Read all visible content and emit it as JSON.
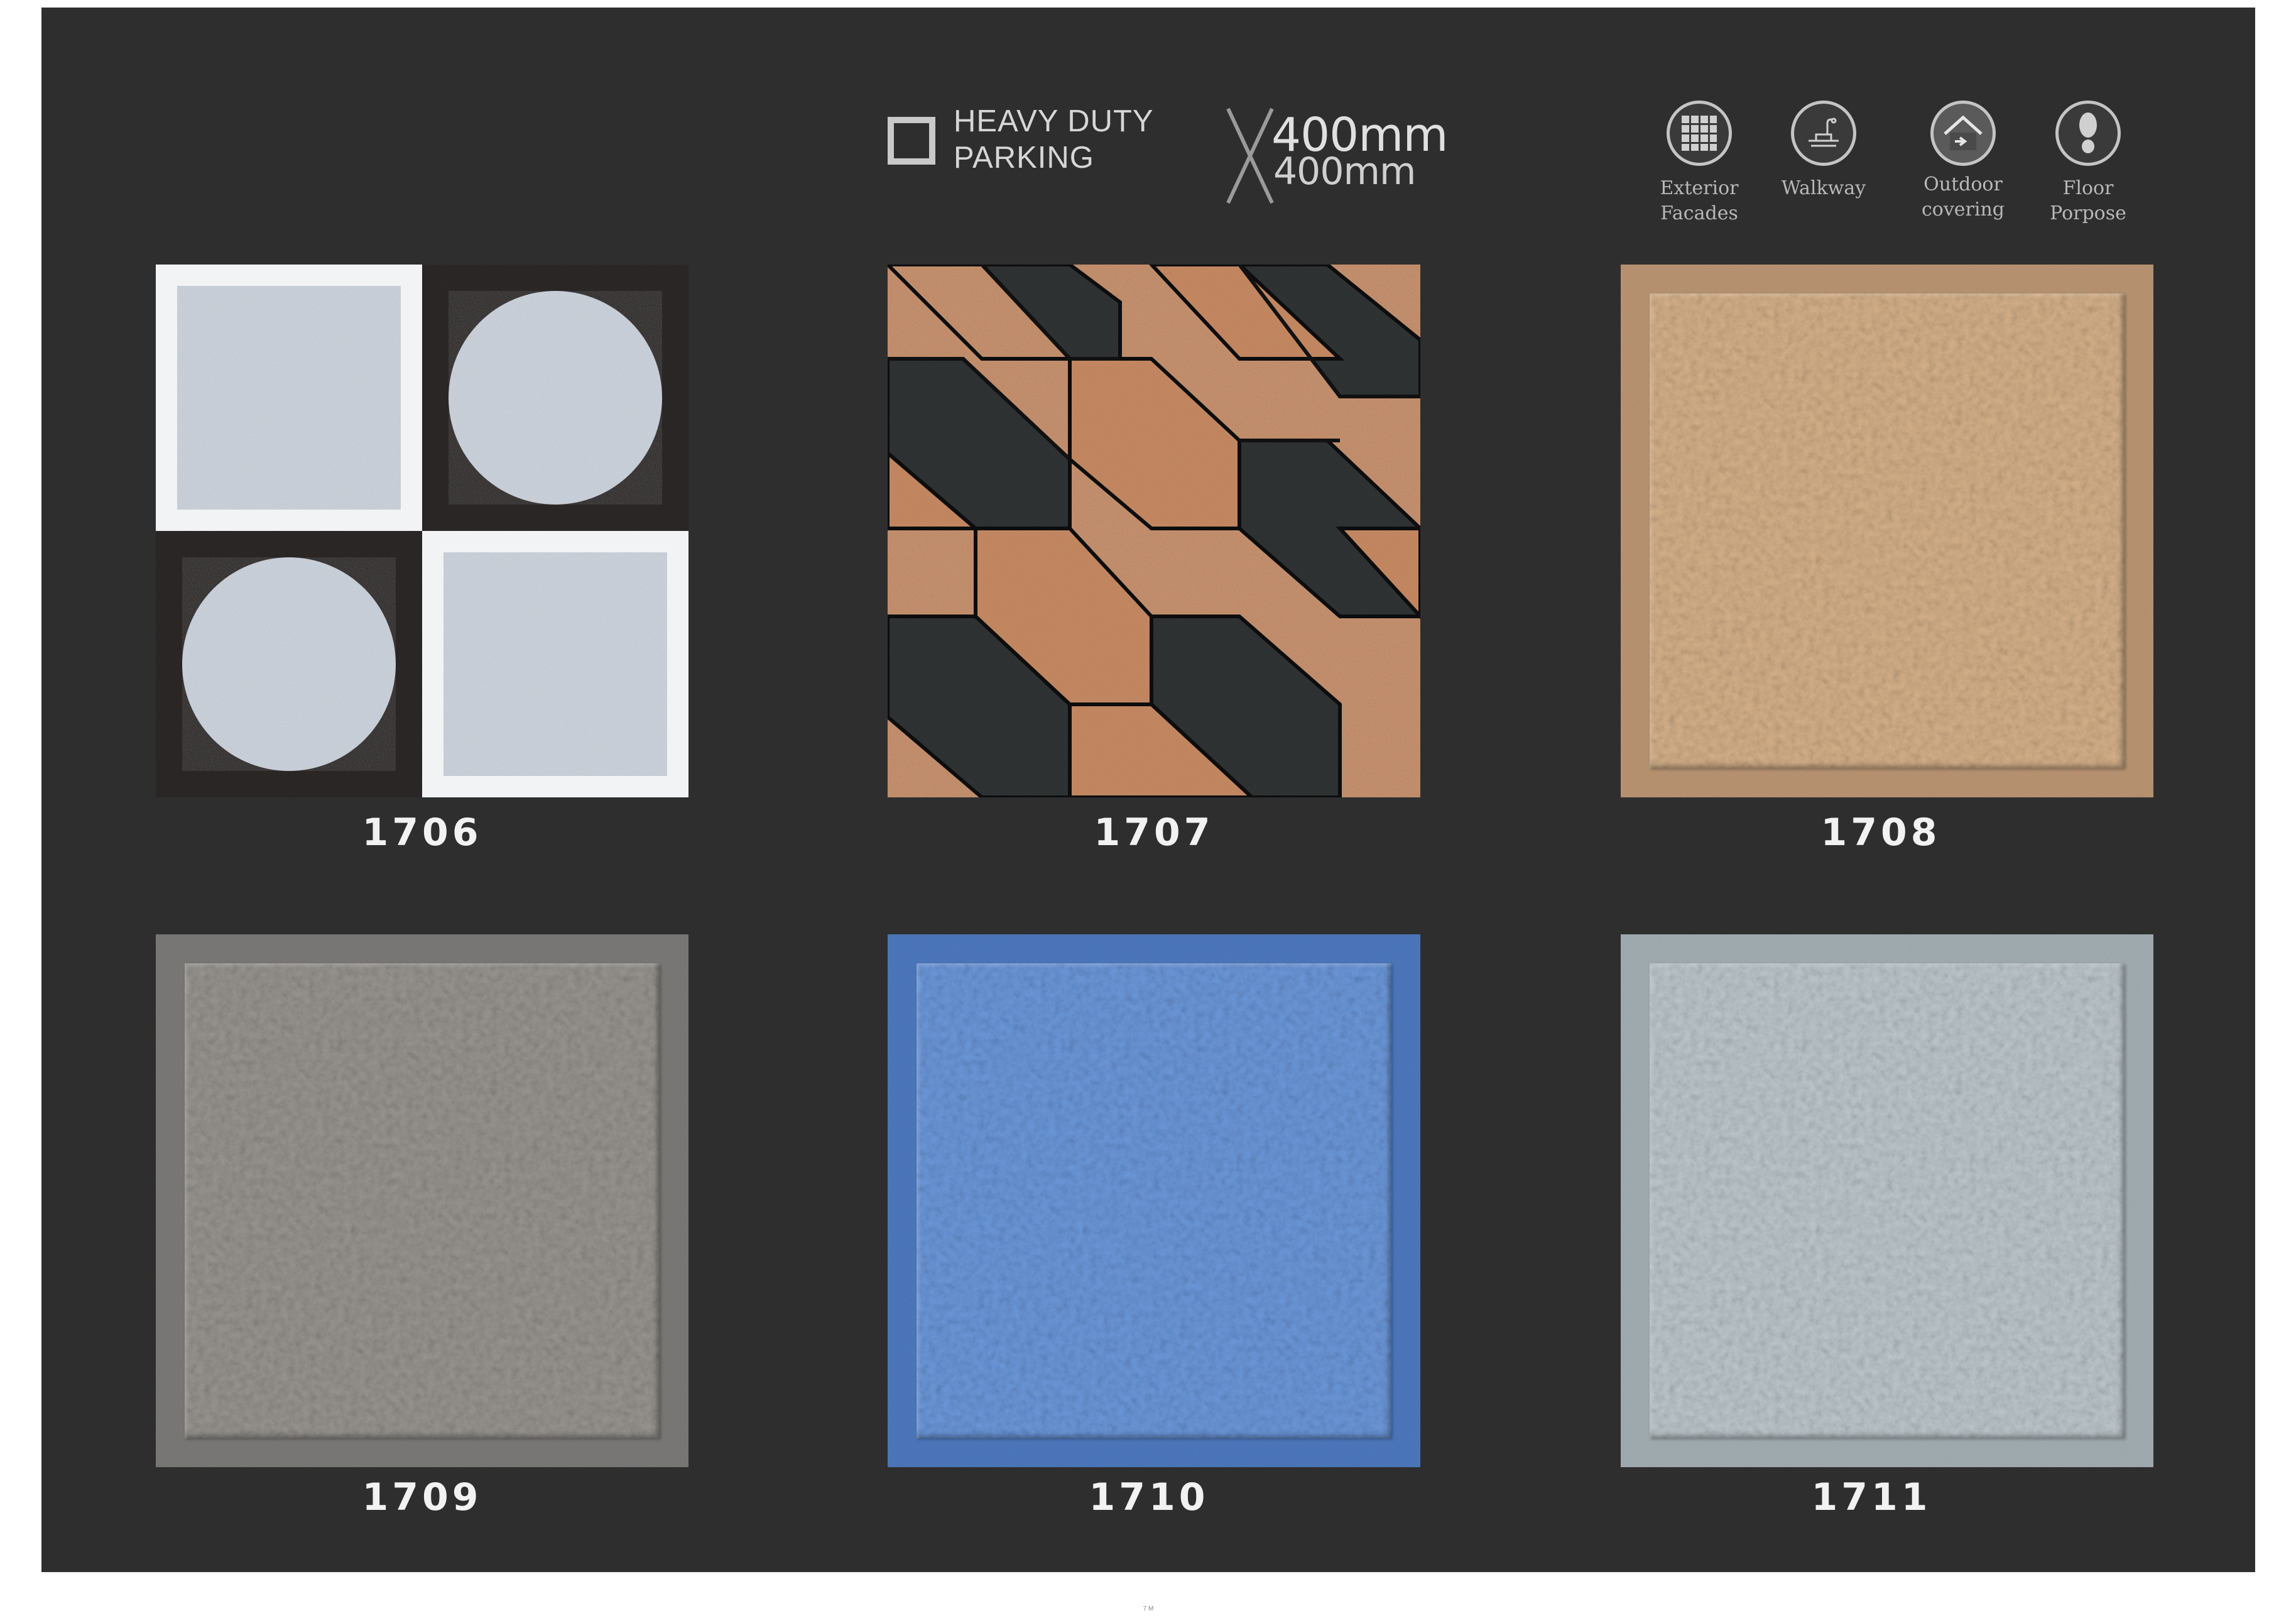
{
  "header": {
    "category_line1": "HEAVY DUTY",
    "category_line2": "PARKING",
    "size_line1": "400mm",
    "size_line2": "400mm"
  },
  "usage_icons": [
    {
      "label": "Exterior\nFacades",
      "icon": "grid-icon"
    },
    {
      "label": "Walkway",
      "icon": "walkway-icon"
    },
    {
      "label": "Outdoor\ncovering",
      "icon": "outdoor-house-icon"
    },
    {
      "label": "Floor\nPorpose",
      "icon": "footprint-icon"
    }
  ],
  "tiles": [
    {
      "code": "1706",
      "color": "#2b2927"
    },
    {
      "code": "1707",
      "color": "#c68a63"
    },
    {
      "code": "1708",
      "color": "#c8a47f"
    },
    {
      "code": "1709",
      "color": "#8a8886"
    },
    {
      "code": "1710",
      "color": "#5a86c9"
    },
    {
      "code": "1711",
      "color": "#a9b3b8"
    }
  ],
  "footer": {
    "page": "7 M"
  }
}
